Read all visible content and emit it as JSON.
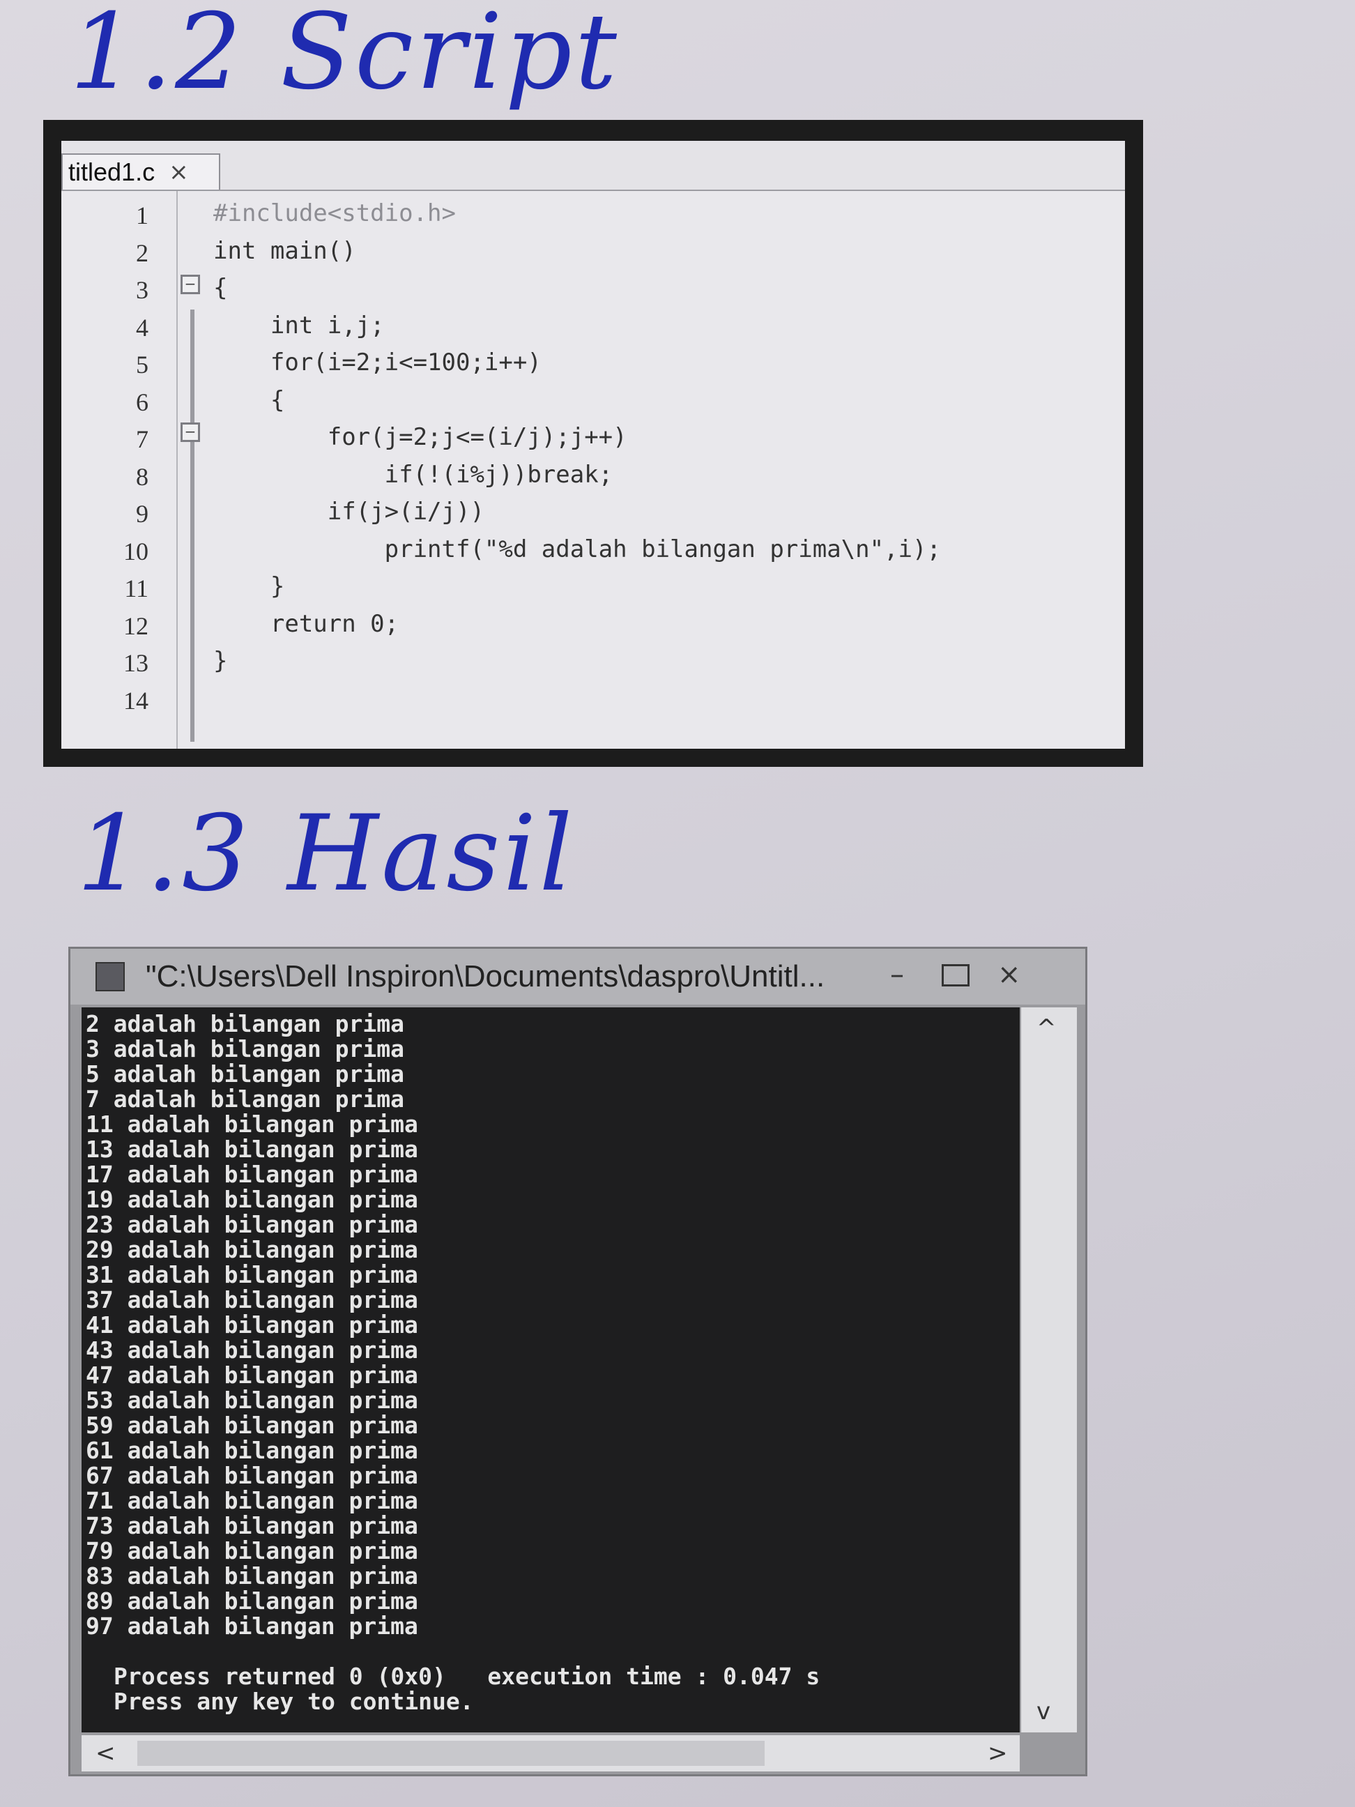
{
  "headings": {
    "script": "1.2 Script",
    "hasil": "1.3 Hasil"
  },
  "editor": {
    "tab_label": "titled1.c",
    "tab_close": "×",
    "lines": [
      {
        "no": "1",
        "code": "#include<stdio.h>"
      },
      {
        "no": "2",
        "code": "int main()"
      },
      {
        "no": "3",
        "code": "{"
      },
      {
        "no": "4",
        "code": "    int i,j;"
      },
      {
        "no": "5",
        "code": "    for(i=2;i<=100;i++)"
      },
      {
        "no": "6",
        "code": "    {"
      },
      {
        "no": "7",
        "code": "        for(j=2;j<=(i/j);j++)"
      },
      {
        "no": "8",
        "code": "            if(!(i%j))break;"
      },
      {
        "no": "9",
        "code": "        if(j>(i/j))"
      },
      {
        "no": "10",
        "code": "            printf(\"%d adalah bilangan prima\\n\",i);"
      },
      {
        "no": "11",
        "code": "    }"
      },
      {
        "no": "12",
        "code": "    return 0;"
      },
      {
        "no": "13",
        "code": "}"
      },
      {
        "no": "14",
        "code": ""
      }
    ]
  },
  "console": {
    "title": "\"C:\\Users\\Dell Inspiron\\Documents\\daspro\\Untitl...",
    "min_icon": "–",
    "close_icon": "×",
    "output": [
      "2 adalah bilangan prima",
      "3 adalah bilangan prima",
      "5 adalah bilangan prima",
      "7 adalah bilangan prima",
      "11 adalah bilangan prima",
      "13 adalah bilangan prima",
      "17 adalah bilangan prima",
      "19 adalah bilangan prima",
      "23 adalah bilangan prima",
      "29 adalah bilangan prima",
      "31 adalah bilangan prima",
      "37 adalah bilangan prima",
      "41 adalah bilangan prima",
      "43 adalah bilangan prima",
      "47 adalah bilangan prima",
      "53 adalah bilangan prima",
      "59 adalah bilangan prima",
      "61 adalah bilangan prima",
      "67 adalah bilangan prima",
      "71 adalah bilangan prima",
      "73 adalah bilangan prima",
      "79 adalah bilangan prima",
      "83 adalah bilangan prima",
      "89 adalah bilangan prima",
      "97 adalah bilangan prima"
    ],
    "footer": [
      "Process returned 0 (0x0)   execution time : 0.047 s",
      "Press any key to continue."
    ],
    "scroll_up": "^",
    "scroll_down": "v",
    "scroll_left": "<",
    "scroll_right": ">"
  }
}
